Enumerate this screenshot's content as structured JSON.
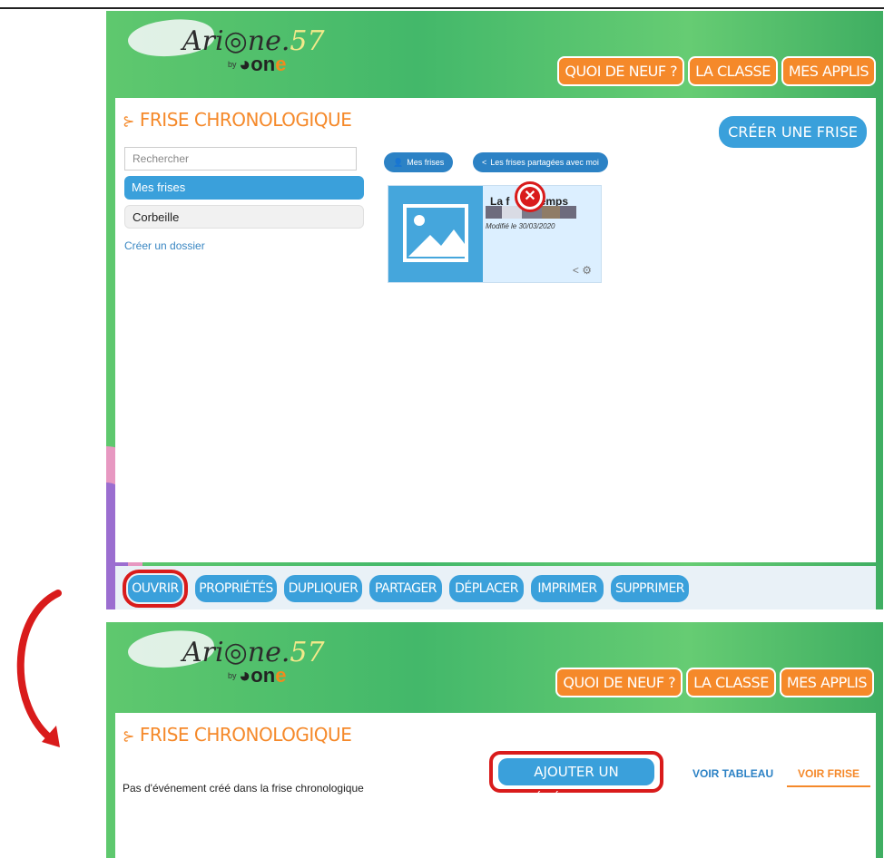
{
  "colors": {
    "orange": "#f5892a",
    "blue": "#3aa0db",
    "green": "#4cbf6d",
    "red": "#d91b1b"
  },
  "panel1": {
    "logo": {
      "brand": "Ari",
      "brand2": "ne.",
      "brand57": "57",
      "by": "by",
      "one": "on",
      "one_e": "e"
    },
    "nav": [
      "QUOI DE NEUF ?",
      "LA CLASSE",
      "MES APPLIS"
    ],
    "title": "FRISE CHRONOLOGIQUE",
    "create_button": "CRÉER UNE FRISE",
    "search_placeholder": "Rechercher",
    "folders": {
      "active": "Mes frises",
      "trash": "Corbeille"
    },
    "create_folder": "Créer un dossier",
    "tabs": {
      "mine": "Mes frises",
      "shared": "Les frises partagées avec moi"
    },
    "card": {
      "title_left": "La f",
      "title_right": "emps",
      "modified": "Modifié le 30/03/2020"
    },
    "toolbar": [
      "OUVRIR",
      "PROPRIÉTÉS",
      "DUPLIQUER",
      "PARTAGER",
      "DÉPLACER",
      "IMPRIMER",
      "SUPPRIMER"
    ]
  },
  "panel2": {
    "logo": {
      "brand": "Ari",
      "brand2": "ne.",
      "brand57": "57",
      "by": "by",
      "one": "on",
      "one_e": "e"
    },
    "nav": [
      "QUOI DE NEUF ?",
      "LA CLASSE",
      "MES APPLIS"
    ],
    "title": "FRISE CHRONOLOGIQUE",
    "add_event_button": "AJOUTER UN ÉVÉNEMENT",
    "view_tabs": [
      "VOIR TABLEAU",
      "VOIR FRISE"
    ],
    "empty_message": "Pas d'événement créé dans la frise chronologique"
  }
}
